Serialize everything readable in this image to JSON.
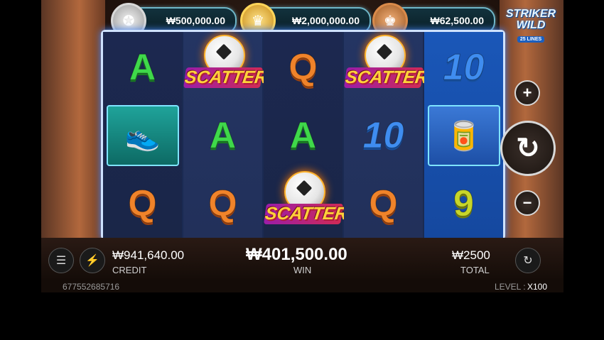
{
  "jackpots": {
    "silver_value": "₩500,000.00",
    "gold_value": "₩2,000,000.00",
    "bronze_value": "₩62,500.00"
  },
  "logo": {
    "line1": "STRIKER",
    "line2": "WILD",
    "lines_badge": "25 LINES"
  },
  "reels": [
    [
      "A",
      "boot-icon",
      "Q"
    ],
    [
      "SCATTER",
      "A",
      "Q"
    ],
    [
      "Q",
      "A",
      "SCATTER"
    ],
    [
      "SCATTER",
      "10",
      "Q"
    ],
    [
      "10",
      "cans-icon",
      "9"
    ]
  ],
  "scatter_label": "SCATTER",
  "side_controls": {
    "plus": "+",
    "minus": "−",
    "spin": "↻"
  },
  "bottom": {
    "credit_value": "₩941,640.00",
    "credit_label": "CREDIT",
    "win_value": "₩401,500.00",
    "win_label": "WIN",
    "total_value": "₩2500",
    "total_label": "TOTAL"
  },
  "footer": {
    "round_id": "677552685716",
    "level_label": "LEVEL :",
    "level_value": "X100"
  },
  "colors": {
    "reel_frame": "#cfe2ff",
    "gold": "#ffd55a",
    "accent_blue": "#1a57b8"
  }
}
